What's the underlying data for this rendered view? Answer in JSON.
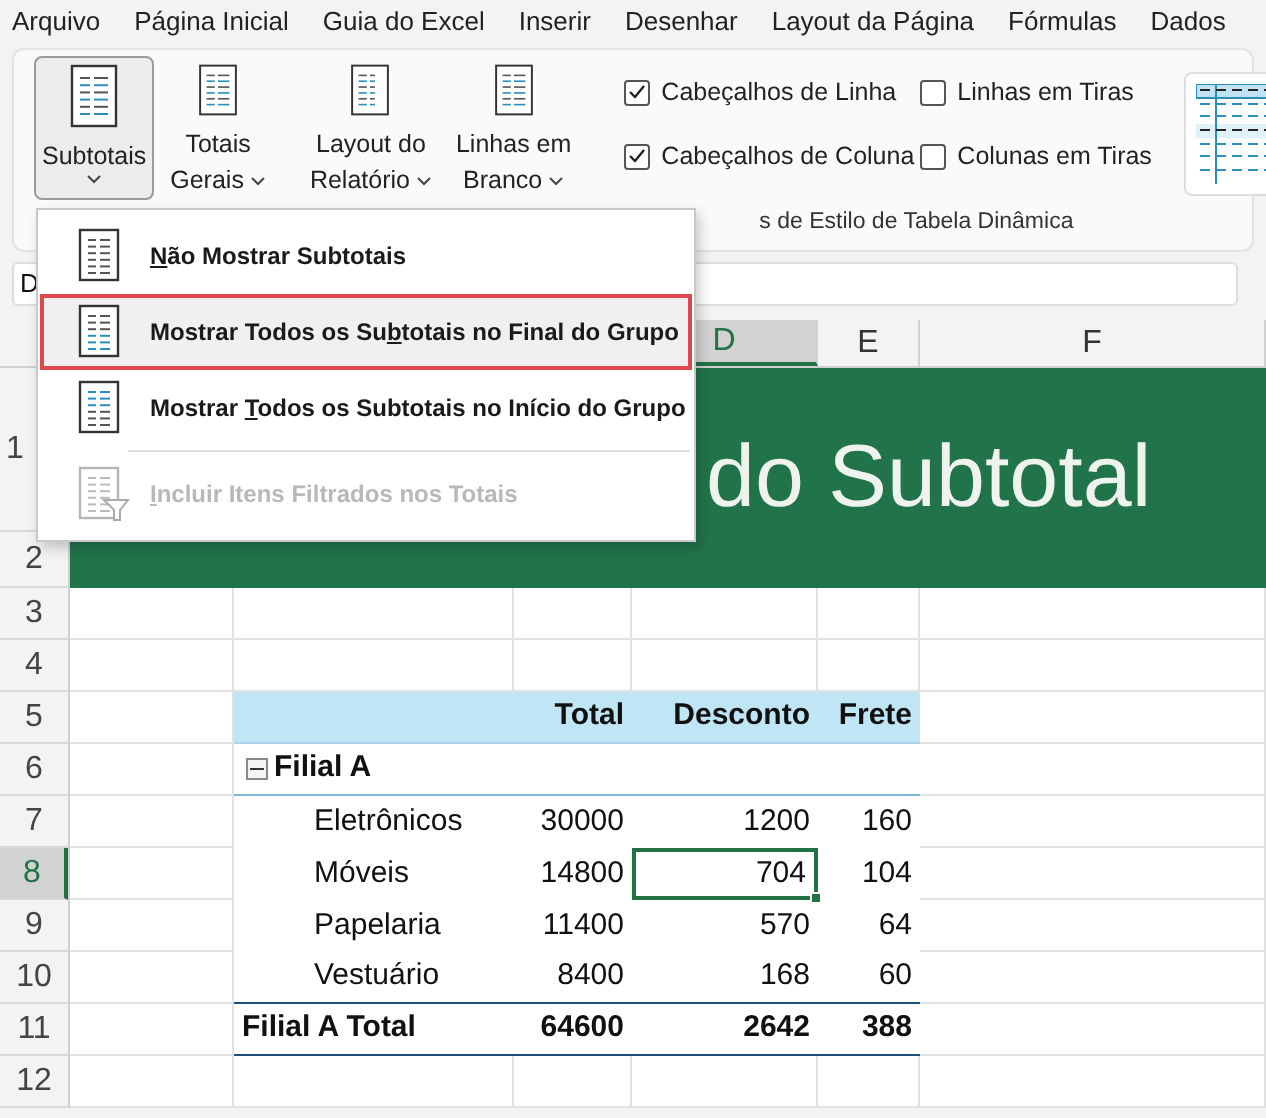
{
  "menu_bar": {
    "tabs": [
      "Arquivo",
      "Página Inicial",
      "Guia do Excel",
      "Inserir",
      "Desenhar",
      "Layout da Página",
      "Fórmulas",
      "Dados"
    ]
  },
  "ribbon": {
    "groups": [
      [
        {
          "label_lines": [
            "Subtotais"
          ],
          "pressed": true
        },
        {
          "label_lines": [
            "Totais",
            "Gerais"
          ],
          "pressed": false
        }
      ],
      [
        {
          "label_lines": [
            "Layout do",
            "Relatório"
          ],
          "pressed": false
        },
        {
          "label_lines": [
            "Linhas em",
            "Branco"
          ],
          "pressed": false
        }
      ]
    ],
    "options": [
      {
        "label": "Cabeçalhos de Linha",
        "checked": true
      },
      {
        "label": "Linhas em Tiras",
        "checked": false
      },
      {
        "label": "Cabeçalhos de Coluna",
        "checked": true
      },
      {
        "label": "Colunas em Tiras",
        "checked": false
      }
    ],
    "group_label": "s de Estilo de Tabela Dinâmica"
  },
  "dropdown": {
    "items": [
      {
        "kind": "plain",
        "key": "N",
        "after": "ão Mostrar Subtotais",
        "selected": false,
        "disabled": false
      },
      {
        "kind": "bottom",
        "before": "Mostrar Todos os Su",
        "key": "b",
        "after": "totais no Final do Grupo",
        "selected": true,
        "disabled": false
      },
      {
        "kind": "top",
        "before": "Mostrar ",
        "key": "T",
        "after": "odos os Subtotais no Início do Grupo",
        "selected": false,
        "disabled": false
      },
      {
        "kind": "filter",
        "key": "I",
        "after": "ncluir Itens Filtrados nos Totais",
        "selected": false,
        "disabled": true
      }
    ]
  },
  "formula_bar": {
    "name_box": "D"
  },
  "sheet": {
    "columns": [
      {
        "label": "D",
        "selected": true
      },
      {
        "label": "E",
        "selected": false
      },
      {
        "label": "F",
        "selected": false
      }
    ],
    "row_numbers": [
      {
        "label": "1",
        "selected": false
      },
      {
        "label": "2",
        "selected": false
      },
      {
        "label": "3",
        "selected": false
      },
      {
        "label": "4",
        "selected": false
      },
      {
        "label": "5",
        "selected": false
      },
      {
        "label": "6",
        "selected": false
      },
      {
        "label": "7",
        "selected": false
      },
      {
        "label": "8",
        "selected": true
      },
      {
        "label": "9",
        "selected": false
      },
      {
        "label": "10",
        "selected": false
      },
      {
        "label": "11",
        "selected": false
      },
      {
        "label": "12",
        "selected": false
      }
    ],
    "title": "do Subtotal",
    "pivot": {
      "headers": [
        "Total",
        "Desconto",
        "Frete"
      ],
      "group": {
        "label": "Filial A",
        "expanded": true
      },
      "items": [
        {
          "label": "Eletrônicos",
          "cells": [
            {
              "text": "30000",
              "selected": false
            },
            {
              "text": "1200",
              "selected": false
            },
            {
              "text": "160",
              "selected": false
            }
          ]
        },
        {
          "label": "Móveis",
          "cells": [
            {
              "text": "14800",
              "selected": false
            },
            {
              "text": "704",
              "selected": true
            },
            {
              "text": "104",
              "selected": false
            }
          ]
        },
        {
          "label": "Papelaria",
          "cells": [
            {
              "text": "11400",
              "selected": false
            },
            {
              "text": "570",
              "selected": false
            },
            {
              "text": "64",
              "selected": false
            }
          ]
        },
        {
          "label": "Vestuário",
          "cells": [
            {
              "text": "8400",
              "selected": false
            },
            {
              "text": "168",
              "selected": false
            },
            {
              "text": "60",
              "selected": false
            }
          ]
        }
      ],
      "total": {
        "label": "Filial A Total",
        "values": [
          "64600",
          "2642",
          "388"
        ]
      }
    }
  }
}
